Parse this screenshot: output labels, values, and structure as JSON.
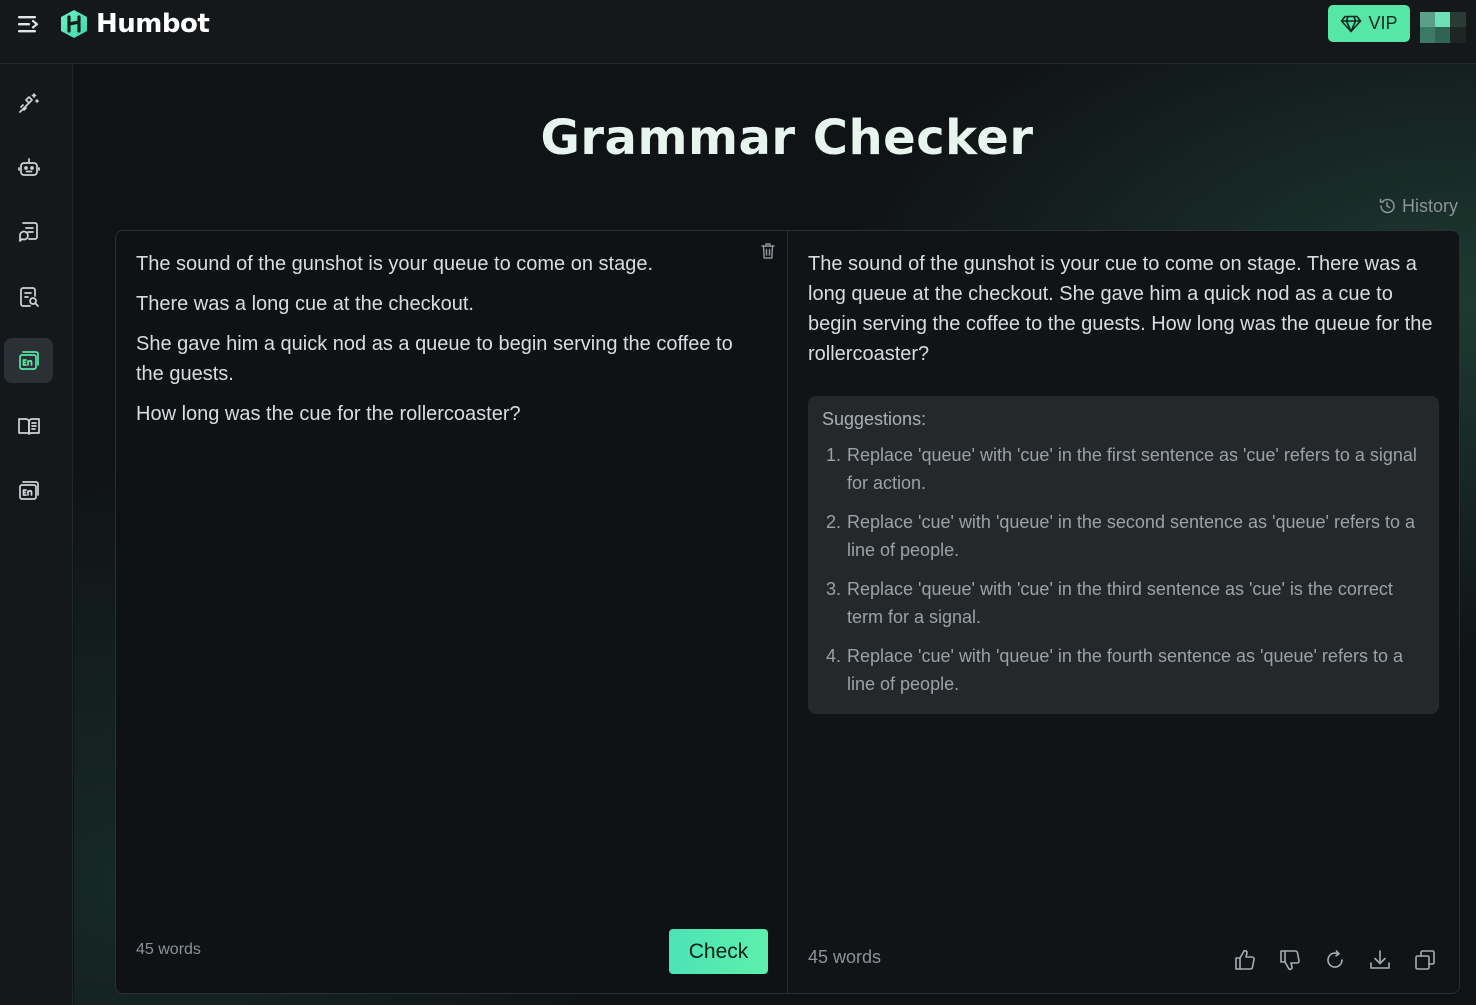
{
  "app": {
    "brand": "Humbot"
  },
  "header": {
    "vip_label": "VIP"
  },
  "sidebar": {
    "items": [
      {
        "icon": "magic-wand-icon"
      },
      {
        "icon": "robot-icon"
      },
      {
        "icon": "chat-document-icon"
      },
      {
        "icon": "document-search-icon"
      },
      {
        "icon": "grammar-checker-icon",
        "active": true
      },
      {
        "icon": "book-icon"
      },
      {
        "icon": "translate-icon"
      }
    ]
  },
  "page": {
    "title": "Grammar Checker",
    "history_label": "History"
  },
  "input": {
    "paragraphs": [
      "The sound of the gunshot is your queue to come on stage.",
      "There was a long cue at the checkout.",
      "She gave him a quick nod as a queue to begin serving the coffee to the guests.",
      "How long was the cue for the rollercoaster?"
    ],
    "word_count": "45 words",
    "check_label": "Check"
  },
  "output": {
    "text": "The sound of the gunshot is your cue to come on stage. There was a long queue at the checkout. She gave him a quick nod as a cue to begin serving the coffee to the guests. How long was the queue for the rollercoaster?",
    "suggestions_title": "Suggestions:",
    "suggestions": [
      {
        "num": "1.",
        "text": "Replace 'queue' with 'cue' in the first sentence as 'cue' refers to a signal for action."
      },
      {
        "num": "2.",
        "text": "Replace 'cue' with 'queue' in the second sentence as 'queue' refers to a line of people."
      },
      {
        "num": "3.",
        "text": "Replace 'queue' with 'cue' in the third sentence as 'cue' is the correct term for a signal."
      },
      {
        "num": "4.",
        "text": "Replace 'cue' with 'queue' in the fourth sentence as 'queue' refers to a line of people."
      }
    ],
    "word_count": "45 words"
  },
  "colors": {
    "accent": "#56e6a6",
    "background": "#111316",
    "panel": "#0f1215",
    "suggestion_bg": "#24282b"
  }
}
